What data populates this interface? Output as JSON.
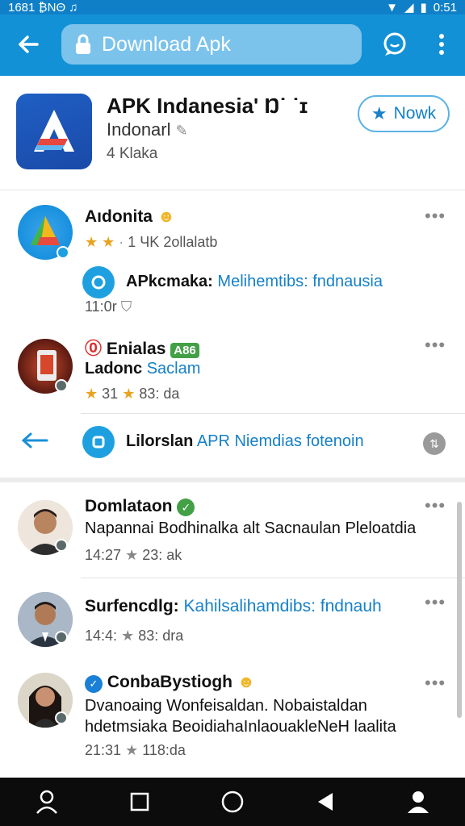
{
  "statusbar": {
    "left": "1681 ₿ΝΘ ♫",
    "time": "0:51"
  },
  "toolbar": {
    "url_title": "Download Apk"
  },
  "header": {
    "title": "APK Indanesia' Ŋ˙ ˙ɪ",
    "subtitle": "Indonarl",
    "downloads": "4 Klaka",
    "now_label": "Nowk"
  },
  "items": [
    {
      "name": "Aıdonita",
      "meta_rating": "1 ЧK 2ollalatb"
    },
    {
      "name": "APkcmaka:",
      "link": "Melihemtibs: fndnausia",
      "time": "11:0r"
    },
    {
      "name": "Enialas",
      "tag": "A86",
      "line_a": "Ladonc",
      "line_b": "Saclam",
      "meta": "31",
      "meta2": "83: da"
    },
    {
      "name": "Lilorslan",
      "link": "APR Niemdias fotenoin"
    }
  ],
  "posts": [
    {
      "name": "Domlataon",
      "text": "Napannai  Bodhinalka alt Sacnaulan Pleloatdia",
      "time": "14:27",
      "count": "23: ak"
    },
    {
      "name": "Surfencdlg:",
      "link": "Kahilsalihamdibs: fndnauh",
      "time": "14:4:",
      "count": "83: dra"
    },
    {
      "name": "ConbaBystiogh",
      "text1": "Dvanoaing Wonfeisaldan. Nobaistaldan",
      "text2": "hdetmsiaka BeoidiahaInlaouakleNeH laalita",
      "time": "21:31",
      "count": "118:da"
    }
  ],
  "more_glyph": "•••"
}
